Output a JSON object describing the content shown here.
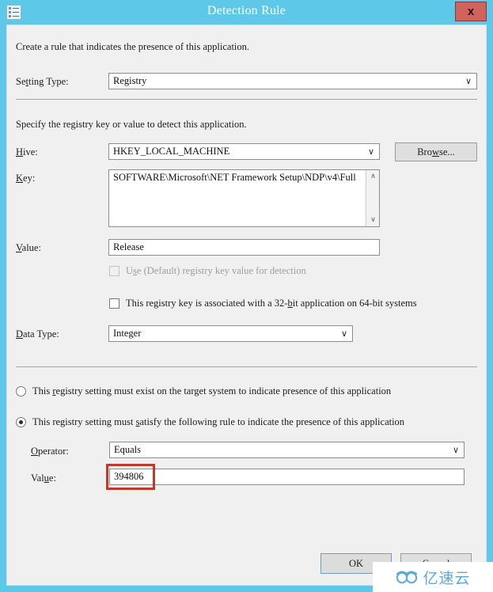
{
  "window": {
    "title": "Detection Rule",
    "icon": "registry-rule-icon",
    "close_label": "x",
    "frame_color": "#5ec8e8",
    "close_color": "#d1625c"
  },
  "intro": {
    "text": "Create a rule that indicates the presence of this application."
  },
  "setting_type": {
    "label": "Setting Type:",
    "label_pre": "Se",
    "label_accel": "t",
    "label_post": "ting Type:",
    "value": "Registry",
    "arrow": "∨"
  },
  "registry_section": {
    "description": "Specify the registry key or value to detect this application.",
    "hive": {
      "label_accel": "H",
      "label_post": "ive:",
      "value": "HKEY_LOCAL_MACHINE",
      "arrow": "∨"
    },
    "browse_button": {
      "pre": "Bro",
      "accel": "w",
      "post": "se..."
    },
    "key": {
      "label_accel": "K",
      "label_post": "ey:",
      "value": "SOFTWARE\\Microsoft\\NET Framework Setup\\NDP\\v4\\Full",
      "scroll_up": "∧",
      "scroll_down": "∨"
    },
    "value": {
      "label_accel": "V",
      "label_post": "alue:",
      "value": "Release"
    },
    "default_key_checkbox": {
      "pre": "U",
      "accel": "s",
      "post": "e (Default) registry key value for detection",
      "checked": false,
      "disabled": true
    },
    "wow64_checkbox": {
      "pre": "This registry key is associated with a 32-",
      "accel": "b",
      "post": "it application on 64-bit systems",
      "checked": false,
      "disabled": false
    },
    "data_type": {
      "label_accel": "D",
      "label_post": "ata Type:",
      "value": "Integer",
      "arrow": "∨"
    }
  },
  "rule_section": {
    "option_exist": {
      "pre": "This ",
      "accel": "r",
      "post": "egistry setting must exist on the target system to indicate presence of this application",
      "selected": false
    },
    "option_satisfy": {
      "pre": "This registry setting must ",
      "accel": "s",
      "post": "atisfy the following rule to indicate the presence of this application",
      "selected": true
    },
    "operator": {
      "label_accel": "O",
      "label_post": "perator:",
      "value": "Equals",
      "arrow": "∨"
    },
    "value": {
      "label_pre": "Val",
      "label_accel": "u",
      "label_post": "e:",
      "value": "394806",
      "highlight_color": "#c0392b"
    }
  },
  "footer": {
    "ok_label": "OK",
    "cancel_label": "Cancel"
  },
  "watermark": {
    "text": "亿速云",
    "logo": "cloud-logo-icon",
    "color": "#5da9d8"
  }
}
